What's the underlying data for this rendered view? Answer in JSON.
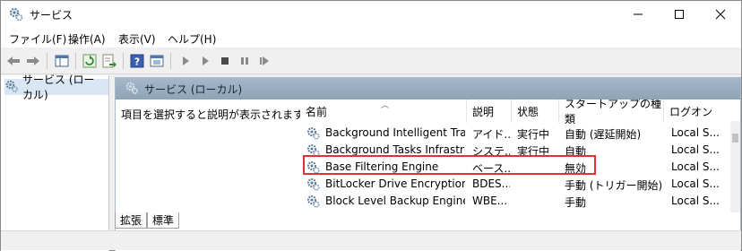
{
  "window": {
    "title": "サービス"
  },
  "caption_buttons": {
    "minimize": "—",
    "maximize": "☐",
    "close": "✕"
  },
  "menu": [
    "ファイル(F)",
    "操作(A)",
    "表示(V)",
    "ヘルプ(H)"
  ],
  "toolbar_icons": [
    "back-arrow-icon",
    "forward-arrow-icon",
    "show-hide-tree-icon",
    "refresh-icon",
    "export-list-icon",
    "help-icon",
    "properties-icon",
    "start-service-icon",
    "start-service-alt-icon",
    "stop-service-icon",
    "pause-service-icon",
    "restart-service-icon"
  ],
  "tree": {
    "item_label": "サービス (ローカル)"
  },
  "right_pane": {
    "header_title": "サービス (ローカル)",
    "description_prompt": "項目を選択すると説明が表示されます。"
  },
  "table": {
    "columns": [
      "名前",
      "説明",
      "状態",
      "スタートアップの種類",
      "ログオン"
    ],
    "rows": [
      {
        "name": "Background Intelligent Tran...",
        "desc": "アイド...",
        "status": "実行中",
        "startup": "自動 (遅延開始)",
        "logon": "Local S..."
      },
      {
        "name": "Background Tasks Infrastruc...",
        "desc": "システ...",
        "status": "実行中",
        "startup": "自動",
        "logon": "Local S..."
      },
      {
        "name": "Base Filtering Engine",
        "desc": "ベース...",
        "status": "",
        "startup": "無効",
        "logon": "Local S..."
      },
      {
        "name": "BitLocker Drive Encryption ...",
        "desc": "BDES...",
        "status": "",
        "startup": "手動 (トリガー開始)",
        "logon": "Local S..."
      },
      {
        "name": "Block Level Backup Engine ...",
        "desc": "WBE...",
        "status": "",
        "startup": "手動",
        "logon": "Local S..."
      }
    ],
    "selected_row_index": 2
  },
  "tabs": [
    "拡張",
    "標準"
  ],
  "colors": {
    "highlight_border": "#e0303a",
    "pane_header": "#9fb2c5",
    "selection": "#d9e7f5"
  }
}
